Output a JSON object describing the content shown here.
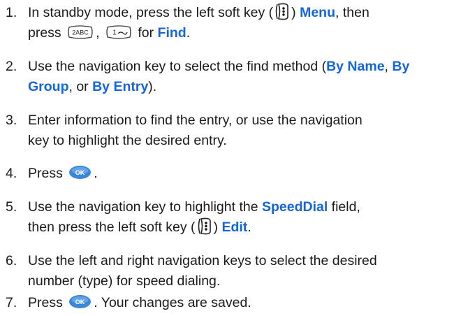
{
  "steps": [
    {
      "number": "1.",
      "line1_a": "In standby mode, press the left soft key (",
      "line1_b": ") ",
      "menu": "Menu",
      "line1_c": ", then",
      "line2_a": "press ",
      "line2_b": ", ",
      "line2_c": " for ",
      "find": "Find",
      "line2_d": ".",
      "key2_label": "2ABC",
      "key1_label": "1"
    },
    {
      "number": "2.",
      "line1": "Use the navigation key to select the find method (",
      "byname": "By Name",
      "sep1": ", ",
      "bygroup": "By Group",
      "sep2": ", or ",
      "byentry": "By Entry",
      "end": ")."
    },
    {
      "number": "3.",
      "line1": "Enter information to find the entry, or use the navigation",
      "line2": "key to highlight the desired entry."
    },
    {
      "number": "4.",
      "text": "Press ",
      "ok_label": "OK",
      "end": "."
    },
    {
      "number": "5.",
      "line1_a": "Use the navigation key to highlight the ",
      "speeddial": "SpeedDial",
      "line1_b": " field,",
      "line2_a": "then press the left soft key (",
      "line2_b": ") ",
      "edit": "Edit",
      "line2_c": "."
    },
    {
      "number": "6.",
      "line1": "Use the left and right navigation keys to select the desired",
      "line2": "number (type) for speed dialing."
    },
    {
      "number": "7.",
      "text": "Press ",
      "ok_label": "OK",
      "end": ". Your changes are saved."
    }
  ],
  "colors": {
    "keyword": "#1565d8",
    "text": "#1a1a1a",
    "ok_key": "#3a87d8"
  }
}
